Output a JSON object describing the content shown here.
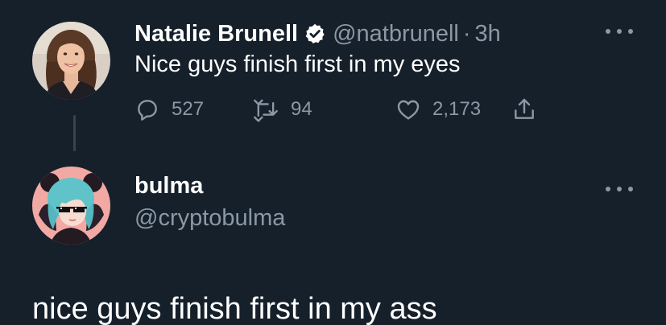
{
  "tweet": {
    "display_name": "Natalie Brunell",
    "verified_icon": "verified-badge-icon",
    "handle": "@natbrunell",
    "separator": "·",
    "time": "3h",
    "text": "Nice guys finish first in my eyes",
    "actions": {
      "reply_count": "527",
      "retweet_count": "94",
      "like_count": "2,173"
    },
    "more_icon": "more-options-icon"
  },
  "reply": {
    "display_name": "bulma",
    "handle": "@cryptobulma",
    "text": "nice guys finish first in my ass",
    "more_icon": "more-options-icon"
  },
  "colors": {
    "background": "#15202b",
    "primary_text": "#ffffff",
    "secondary_text": "#8b98a5",
    "thread_line": "#38444d",
    "verified_badge": "#ffffff"
  }
}
